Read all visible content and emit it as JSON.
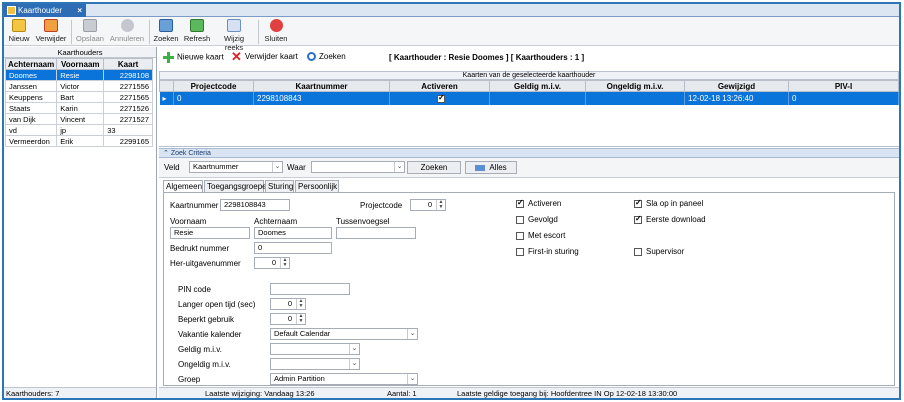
{
  "window": {
    "tab_title": "Kaarthouder",
    "close_glyph": "×"
  },
  "toolbar": {
    "nieuw": "Nieuw",
    "verwijder": "Verwijder",
    "opslaan": "Opslaan",
    "annuleren": "Annuleren",
    "zoeken": "Zoeken",
    "refresh": "Refresh",
    "wijzig_reeks": "Wijzig reeks",
    "sluiten": "Sluiten"
  },
  "left": {
    "title": "Kaarthouders",
    "columns": [
      "Achternaam",
      "Voornaam",
      "Kaart"
    ],
    "rows": [
      [
        "Doomes",
        "Resie",
        "2298108"
      ],
      [
        "Janssen",
        "Victor",
        "2271556"
      ],
      [
        "Keuppens",
        "Bart",
        "2271565"
      ],
      [
        "Staats",
        "Karin",
        "2271526"
      ],
      [
        "van Dijk",
        "Vincent",
        "2271527"
      ],
      [
        "vd",
        "jp",
        "33"
      ],
      [
        "Vermeerdon",
        "Erik",
        "2299165"
      ]
    ],
    "footer": "Kaarthouders: 7"
  },
  "subtoolbar": {
    "nieuwe_kaart": "Nieuwe kaart",
    "verwijder_kaart": "Verwijder kaart",
    "zoeken": "Zoeken",
    "status": "[ Kaarthouder : Resie Doomes ]   [ Kaarthouders : 1 ]"
  },
  "cards": {
    "caption": "Kaarten van de geselecteerde kaarthouder",
    "columns": [
      "Projectcode",
      "Kaartnummer",
      "Activeren",
      "Geldig m.i.v.",
      "Ongeldig m.i.v.",
      "Gewijzigd",
      "PIV-I"
    ],
    "row": {
      "indicator": "▸",
      "projectcode": "0",
      "kaartnummer": "2298108843",
      "activeren": true,
      "geldig": "",
      "ongeldig": "",
      "gewijzigd": "12-02-18 13:26:40",
      "pivi": "0"
    }
  },
  "zoek": {
    "header": "Zoek Criteria",
    "veld_label": "Veld",
    "veld_value": "Kaartnummer",
    "waar_label": "Waar",
    "waar_value": "",
    "zoeken_btn": "Zoeken",
    "alles_btn": "Alles"
  },
  "tabs": [
    "Algemeen",
    "Toegangsgroepen",
    "Sturing",
    "Persoonlijk"
  ],
  "form": {
    "kaartnummer_label": "Kaartnummer",
    "kaartnummer": "2298108843",
    "projectcode_label": "Projectcode",
    "projectcode": "0",
    "voornaam_label": "Voornaam",
    "voornaam": "Resie",
    "achternaam_label": "Achternaam",
    "achternaam": "Doomes",
    "tussenvoegsel_label": "Tussenvoegsel",
    "tussenvoegsel": "",
    "bedrukt_label": "Bedrukt nummer",
    "bedrukt": "0",
    "heruitgave_label": "Her-uitgavenummer",
    "heruitgave": "0",
    "pin_label": "PIN code",
    "pin": "",
    "langer_label": "Langer open tijd (sec)",
    "langer": "0",
    "beperkt_label": "Beperkt gebruik",
    "beperkt": "0",
    "vakantie_label": "Vakantie kalender",
    "vakantie": "Default Calendar",
    "geldig_label": "Geldig m.i.v.",
    "geldig": "",
    "ongeldig_label": "Ongeldig m.i.v.",
    "ongeldig": "",
    "groep_label": "Groep",
    "groep": "Admin Partition"
  },
  "checks": {
    "activeren": {
      "label": "Activeren",
      "checked": true
    },
    "gevolgd": {
      "label": "Gevolgd",
      "checked": false
    },
    "met_escort": {
      "label": "Met escort",
      "checked": false
    },
    "first_in": {
      "label": "First-in sturing",
      "checked": false
    },
    "sla_op": {
      "label": "Sla op in paneel",
      "checked": true
    },
    "eerste_download": {
      "label": "Eerste download",
      "checked": true
    },
    "supervisor": {
      "label": "Supervisor",
      "checked": false
    }
  },
  "status": {
    "laatste_wijziging": "Laatste wijziging: Vandaag 13:26",
    "aantal": "Aantal: 1",
    "toegang": "Laatste geldige toegang bij: Hoofdentree IN  Op 12-02-18 13:30:00"
  },
  "colors": {
    "accent": "#2e75b6",
    "selection": "#0a74da",
    "toolbar_bg": "#f5f6f8"
  },
  "icons": {
    "nieuw": "new-card-icon",
    "verwijder": "delete-card-icon",
    "opslaan": "save-icon",
    "annuleren": "cancel-icon",
    "zoeken": "search-user-icon",
    "refresh": "refresh-icon",
    "wijzig_reeks": "edit-series-icon",
    "sluiten": "close-circle-icon"
  }
}
